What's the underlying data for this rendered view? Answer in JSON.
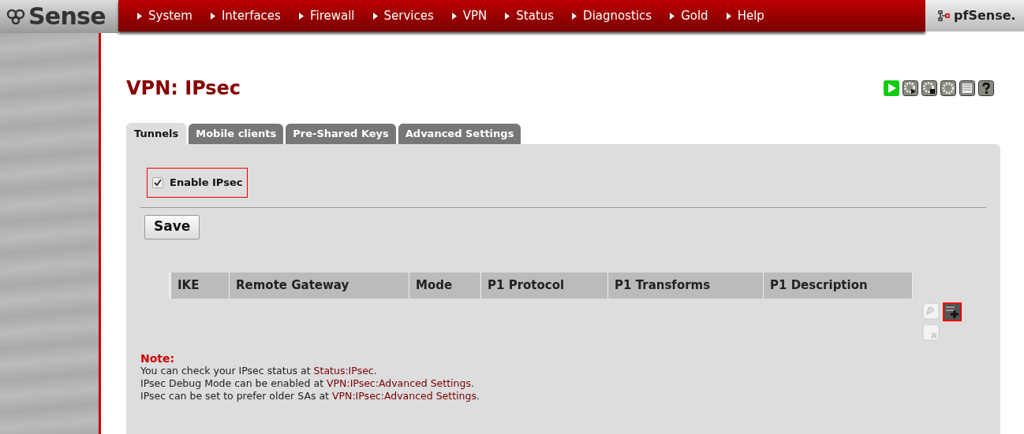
{
  "logo": {
    "text": "Sense"
  },
  "menu": [
    {
      "label": "System"
    },
    {
      "label": "Interfaces"
    },
    {
      "label": "Firewall"
    },
    {
      "label": "Services"
    },
    {
      "label": "VPN"
    },
    {
      "label": "Status"
    },
    {
      "label": "Diagnostics"
    },
    {
      "label": "Gold"
    },
    {
      "label": "Help"
    }
  ],
  "host": {
    "label": "pfSense."
  },
  "page_title": "VPN: IPsec",
  "tabs": [
    {
      "label": "Tunnels",
      "selected": true
    },
    {
      "label": "Mobile clients",
      "selected": false
    },
    {
      "label": "Pre-Shared Keys",
      "selected": false
    },
    {
      "label": "Advanced Settings",
      "selected": false
    }
  ],
  "enable": {
    "label": "Enable IPsec",
    "checked": true
  },
  "save_button": "Save",
  "table": {
    "columns": [
      "IKE",
      "Remote Gateway",
      "Mode",
      "P1 Protocol",
      "P1 Transforms",
      "P1 Description"
    ]
  },
  "note": {
    "title": "Note:",
    "lines": [
      {
        "text": "You can check your IPsec status at ",
        "link": "Status:IPsec",
        "end": "."
      },
      {
        "text": "IPsec Debug Mode can be enabled at ",
        "link": "VPN:IPsec:Advanced Settings",
        "end": "."
      },
      {
        "text": "IPsec can be set to prefer older SAs at ",
        "link": "VPN:IPsec:Advanced Settings",
        "end": "."
      }
    ]
  }
}
